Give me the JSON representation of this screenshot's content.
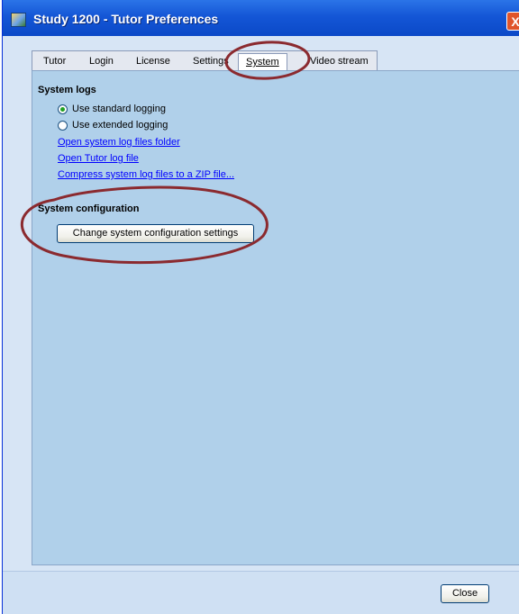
{
  "window": {
    "title": "Study 1200 - Tutor Preferences",
    "close_glyph": "X"
  },
  "tabs": [
    {
      "label": "Tutor",
      "active": false
    },
    {
      "label": "Login",
      "active": false
    },
    {
      "label": "License",
      "active": false
    },
    {
      "label": "Settings",
      "active": false
    },
    {
      "label": "System",
      "active": true
    },
    {
      "label": "Video stream",
      "active": false
    }
  ],
  "system_logs": {
    "title": "System logs",
    "options": [
      {
        "label": "Use standard logging",
        "selected": true
      },
      {
        "label": "Use extended logging",
        "selected": false
      }
    ],
    "links": [
      "Open system log files folder",
      "Open Tutor log file",
      "Compress system log files to a ZIP file..."
    ]
  },
  "system_configuration": {
    "title": "System configuration",
    "button_label": "Change system configuration settings"
  },
  "footer": {
    "close_label": "Close"
  },
  "colors": {
    "titlebar": "#0b49c7",
    "panel": "#b0d0ea",
    "annotation": "#8b2a2f",
    "link": "#0000ff"
  }
}
